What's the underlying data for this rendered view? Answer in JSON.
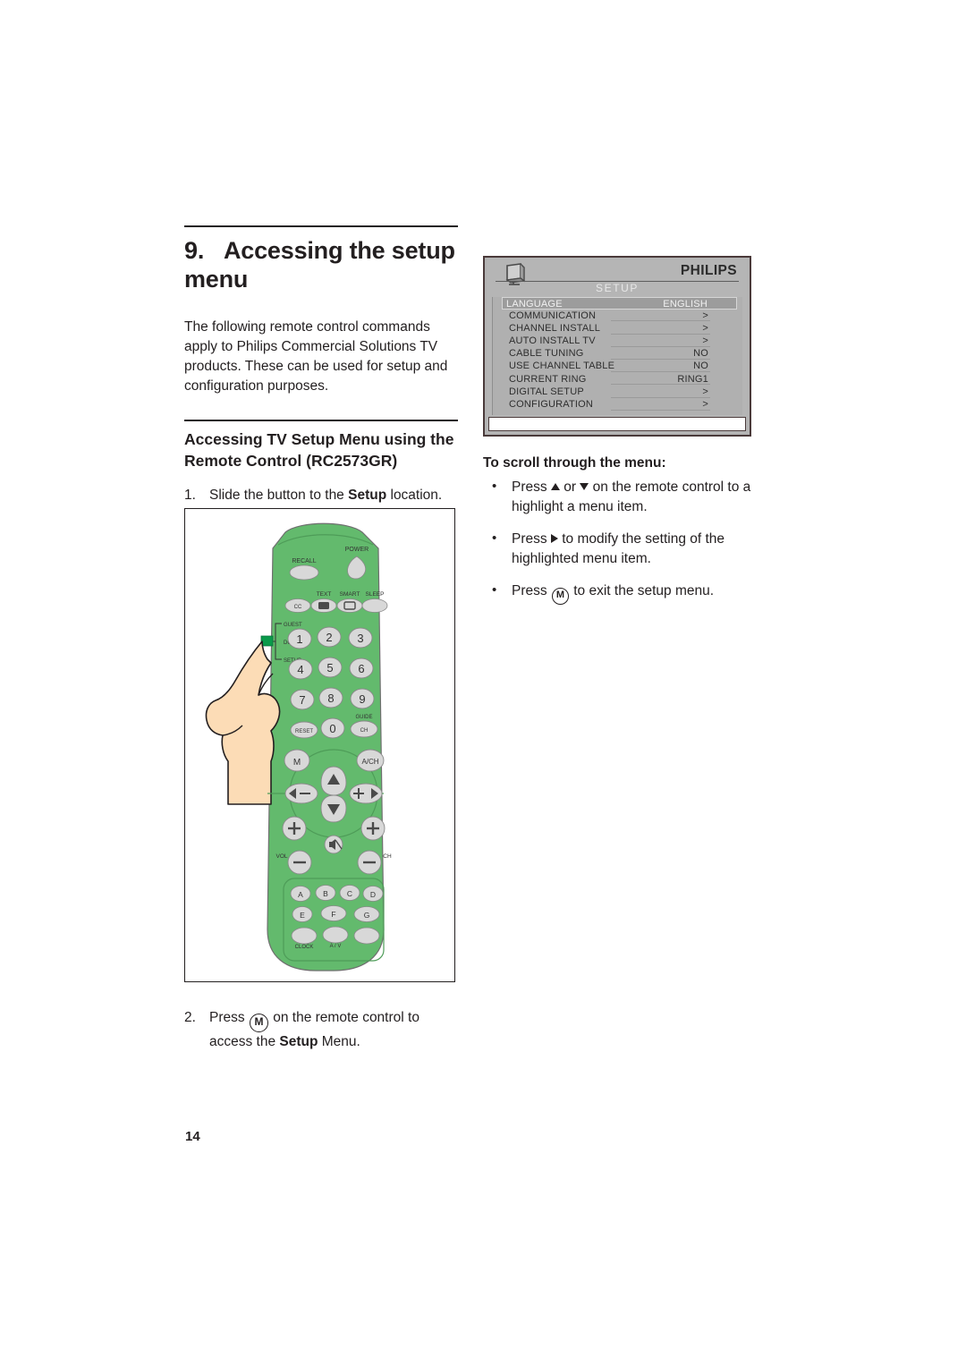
{
  "document": {
    "page_number": "14"
  },
  "left_column": {
    "chapter_number": "9.",
    "chapter_title": "Accessing the setup menu",
    "intro_paragraph": "The following remote control commands apply to Philips Commercial Solutions TV products. These can be used for setup and configuration purposes.",
    "section_title": "Accessing TV Setup Menu using the Remote Control (RC2573GR)",
    "step1": {
      "number": "1.",
      "text_before": "Slide the button to the ",
      "bold": "Setup",
      "text_after": " location."
    },
    "step2": {
      "number": "2.",
      "text_before": "Press ",
      "key": "M",
      "text_mid": " on the remote control to access the ",
      "bold": "Setup",
      "text_after": " Menu."
    }
  },
  "remote": {
    "body_color": "#63ba6d",
    "button_color": "#d8d8d8",
    "switch_color": "#0a9a4a",
    "hand_color": "#fcdcb6",
    "labels": {
      "recall": "RECALL",
      "power": "POWER",
      "cc": "CC",
      "text": "TEXT",
      "smart": "SMART",
      "sleep": "SLEEP",
      "guest": "GUEST",
      "dcm": "DCM",
      "setup": "SETUP",
      "reset": "RESET",
      "guide": "GUIDE",
      "ch_small": "CH",
      "menu": "M",
      "av_ch": "A/CH",
      "vol": "VOL",
      "ch": "CH",
      "clock": "CLOCK",
      "av": "A / V"
    },
    "keypad": [
      "1",
      "2",
      "3",
      "4",
      "5",
      "6",
      "7",
      "8",
      "9",
      "0"
    ],
    "letter_keys": [
      "A",
      "B",
      "C",
      "D",
      "E",
      "F",
      "G"
    ]
  },
  "osd_menu": {
    "brand": "PHILIPS",
    "title": "SETUP",
    "rows": [
      {
        "label": "LANGUAGE",
        "value": "ENGLISH",
        "selected": true
      },
      {
        "label": "COMMUNICATION",
        "value": ">",
        "selected": false
      },
      {
        "label": "CHANNEL INSTALL",
        "value": ">",
        "selected": false
      },
      {
        "label": "AUTO INSTALL TV",
        "value": ">",
        "selected": false
      },
      {
        "label": "CABLE TUNING",
        "value": "NO",
        "selected": false
      },
      {
        "label": "USE CHANNEL TABLE",
        "value": "NO",
        "selected": false
      },
      {
        "label": "CURRENT RING",
        "value": "RING1",
        "selected": false
      },
      {
        "label": "DIGITAL SETUP",
        "value": ">",
        "selected": false
      },
      {
        "label": "CONFIGURATION",
        "value": ">",
        "selected": false
      }
    ]
  },
  "right_column": {
    "heading": "To scroll through the menu:",
    "bullets": [
      {
        "parts_1": "Press ",
        "icon_1": "triangle-up",
        "parts_2": " or ",
        "icon_2": "triangle-down",
        "parts_3": " on the remote control to a highlight a menu item."
      },
      {
        "parts_1": "Press ",
        "icon_1": "triangle-right",
        "parts_2": " to modify the setting of the highlighted menu item."
      },
      {
        "parts_1": "Press ",
        "icon_1": "m-key",
        "key_label": "M",
        "parts_2": " to exit the setup menu."
      }
    ]
  }
}
